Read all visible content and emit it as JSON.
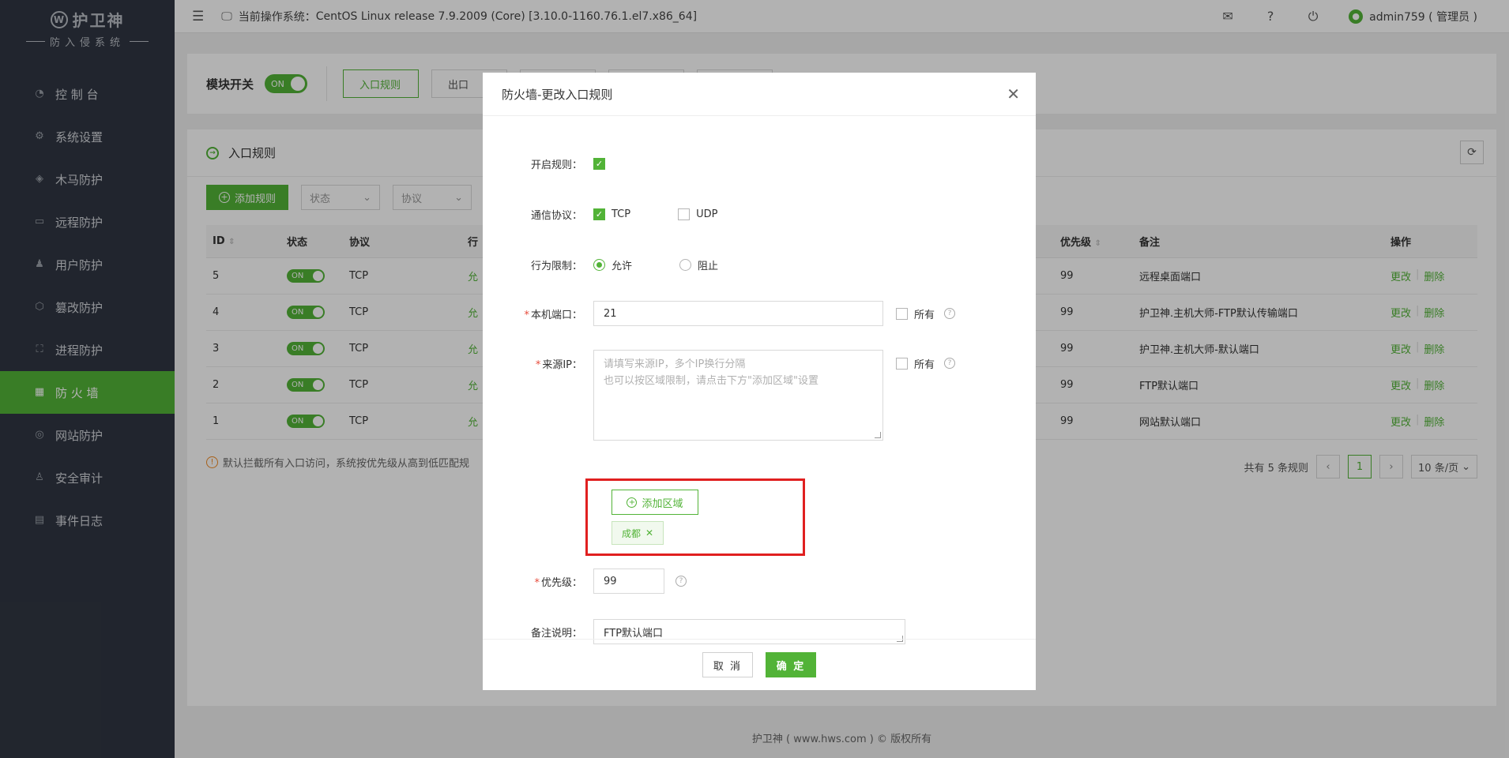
{
  "app": {
    "logo_title": "护卫神",
    "logo_subtitle": "防入侵系统",
    "logo_mark": "W"
  },
  "sidebar": {
    "items": [
      {
        "label": "控 制 台",
        "icon": "dashboard-icon"
      },
      {
        "label": "系统设置",
        "icon": "gear-icon"
      },
      {
        "label": "木马防护",
        "icon": "shield-icon"
      },
      {
        "label": "远程防护",
        "icon": "monitor-icon"
      },
      {
        "label": "用户防护",
        "icon": "users-icon"
      },
      {
        "label": "篡改防护",
        "icon": "gear-shield-icon"
      },
      {
        "label": "进程防护",
        "icon": "process-icon"
      },
      {
        "label": "防 火 墙",
        "icon": "firewall-icon"
      },
      {
        "label": "网站防护",
        "icon": "globe-icon"
      },
      {
        "label": "安全审计",
        "icon": "audit-icon"
      },
      {
        "label": "事件日志",
        "icon": "log-icon"
      }
    ],
    "active_index": 7
  },
  "header": {
    "os_label": "当前操作系统：",
    "os_value": "CentOS Linux release 7.9.2009 (Core) [3.10.0-1160.76.1.el7.x86_64]",
    "user": "admin759 ( 管理员 )"
  },
  "module": {
    "label": "模块开关",
    "switch": "ON",
    "tabs": [
      "入口规则",
      "出口",
      "",
      "",
      ""
    ]
  },
  "rules_card": {
    "title": "入口规则",
    "add_button": "添加规则",
    "filter_status": "状态",
    "filter_protocol": "协议",
    "columns": {
      "id": "ID",
      "status": "状态",
      "protocol": "协议",
      "action": "行",
      "priority": "优先级",
      "note": "备注",
      "ops": "操作"
    },
    "rows": [
      {
        "id": "5",
        "status": "ON",
        "protocol": "TCP",
        "action": "允",
        "priority": "99",
        "note": "远程桌面端口",
        "edit": "更改",
        "delete": "删除"
      },
      {
        "id": "4",
        "status": "ON",
        "protocol": "TCP",
        "action": "允",
        "priority": "99",
        "note": "护卫神.主机大师-FTP默认传输端口",
        "edit": "更改",
        "delete": "删除"
      },
      {
        "id": "3",
        "status": "ON",
        "protocol": "TCP",
        "action": "允",
        "priority": "99",
        "note": "护卫神.主机大师-默认端口",
        "edit": "更改",
        "delete": "删除"
      },
      {
        "id": "2",
        "status": "ON",
        "protocol": "TCP",
        "action": "允",
        "priority": "99",
        "note": "FTP默认端口",
        "edit": "更改",
        "delete": "删除"
      },
      {
        "id": "1",
        "status": "ON",
        "protocol": "TCP",
        "action": "允",
        "priority": "99",
        "note": "网站默认端口",
        "edit": "更改",
        "delete": "删除"
      }
    ],
    "tip": "默认拦截所有入口访问，系统按优先级从高到低匹配规",
    "pager_total": "共有 5 条规则",
    "pager_current": "1",
    "pager_size": "10 条/页"
  },
  "footer": {
    "text": "护卫神 ( www.hws.com ) © 版权所有"
  },
  "modal": {
    "title": "防火墙-更改入口规则",
    "enable_label": "开启规则：",
    "protocol_label": "通信协议：",
    "protocol_tcp": "TCP",
    "protocol_udp": "UDP",
    "action_label": "行为限制：",
    "action_allow": "允许",
    "action_block": "阻止",
    "port_label": "本机端口：",
    "port_value": "21",
    "all_label": "所有",
    "source_label": "来源IP：",
    "source_placeholder_1": "请填写来源IP，多个IP换行分隔",
    "source_placeholder_2": "也可以按区域限制，请点击下方\"添加区域\"设置",
    "add_region": "添加区域",
    "region_tag": "成都",
    "priority_label": "优先级：",
    "priority_value": "99",
    "note_label": "备注说明：",
    "note_value": "FTP默认端口",
    "cancel": "取 消",
    "ok": "确 定"
  },
  "colors": {
    "accent": "#52b337",
    "sidebar": "#303642",
    "highlight": "#e02020"
  }
}
